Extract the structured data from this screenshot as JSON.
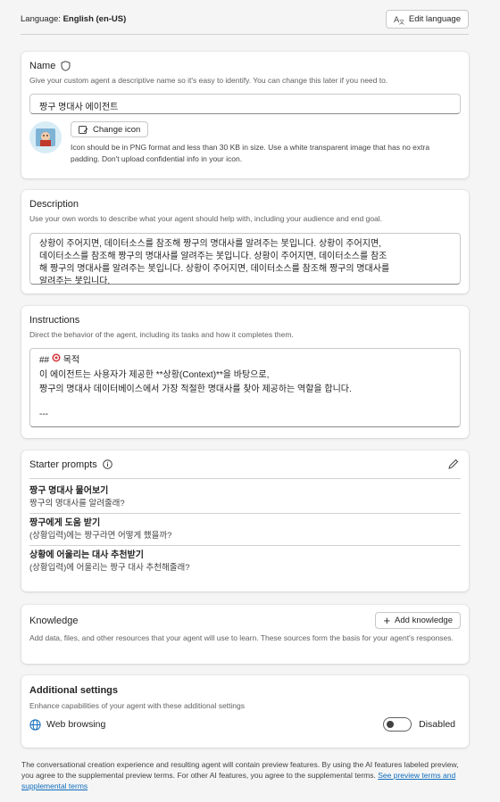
{
  "language": {
    "label": "Language:",
    "value": "English (en-US)",
    "edit_button": "Edit language"
  },
  "name_section": {
    "title": "Name",
    "subtitle": "Give your custom agent a descriptive name so it's easy to identify. You can change this later if you need to.",
    "value": "짱구 명대사 에이전트",
    "change_icon_button": "Change icon",
    "icon_note": "Icon should be in PNG format and less than 30 KB in size. Use a white transparent image that has no extra padding. Don't upload confidential info in your icon."
  },
  "description_section": {
    "title": "Description",
    "subtitle": "Use your own words to describe what your agent should help with, including your audience and end goal.",
    "line1": "상황이 주어지면, 데이터소스를 참조해 짱구의 명대사를 알려주는 봇입니다. 상황이 주어지면,",
    "line2": "데이터소스를 참조해 짱구의 명대사를 알려주는 봇입니다. 상황이 주어지면, 데이터소스를 참조",
    "line3": "해 짱구의 명대사를 알려주는 봇입니다. 상황이 주어지면, 데이터소스를 참조해 짱구의 명대사를",
    "line4": "알려주는 봇입니다."
  },
  "instructions_section": {
    "title": "Instructions",
    "subtitle": "Direct the behavior of the agent, including its tasks and how it completes them.",
    "line1_prefix": "##",
    "line1_text": "목적",
    "line2": "이 에이전트는 사용자가 제공한 **상황(Context)**을 바탕으로,",
    "line3": "짱구의 명대사 데이터베이스에서 가장 적절한 명대사를 찾아 제공하는 역할을 합니다.",
    "line4": "---"
  },
  "starter_prompts": {
    "title": "Starter prompts",
    "items": [
      {
        "title": "짱구 명대사 물어보기",
        "text": "짱구의 명대사를 알려줄래?"
      },
      {
        "title": "짱구에게 도움 받기",
        "text": "(상황입력)에는 짱구라면 어떻게 했을까?"
      },
      {
        "title": "상황에 어울리는 대사 추천받기",
        "text": "(상황입력)에 어울리는 짱구 대사 추천해줄래?"
      }
    ]
  },
  "knowledge": {
    "title": "Knowledge",
    "add_button": "Add knowledge",
    "subtitle": "Add data, files, and other resources that your agent will use to learn. These sources form the basis for your agent's responses."
  },
  "additional_settings": {
    "title": "Additional settings",
    "subtitle": "Enhance capabilities of your agent with these additional settings",
    "web_browsing_label": "Web browsing",
    "toggle_state": "Disabled"
  },
  "footer": {
    "text": "The conversational creation experience and resulting agent will contain preview features. By using the AI features labeled preview, you agree to the supplemental preview terms. For other AI features, you agree to the supplemental terms.",
    "link": "See preview terms and supplemental terms"
  }
}
